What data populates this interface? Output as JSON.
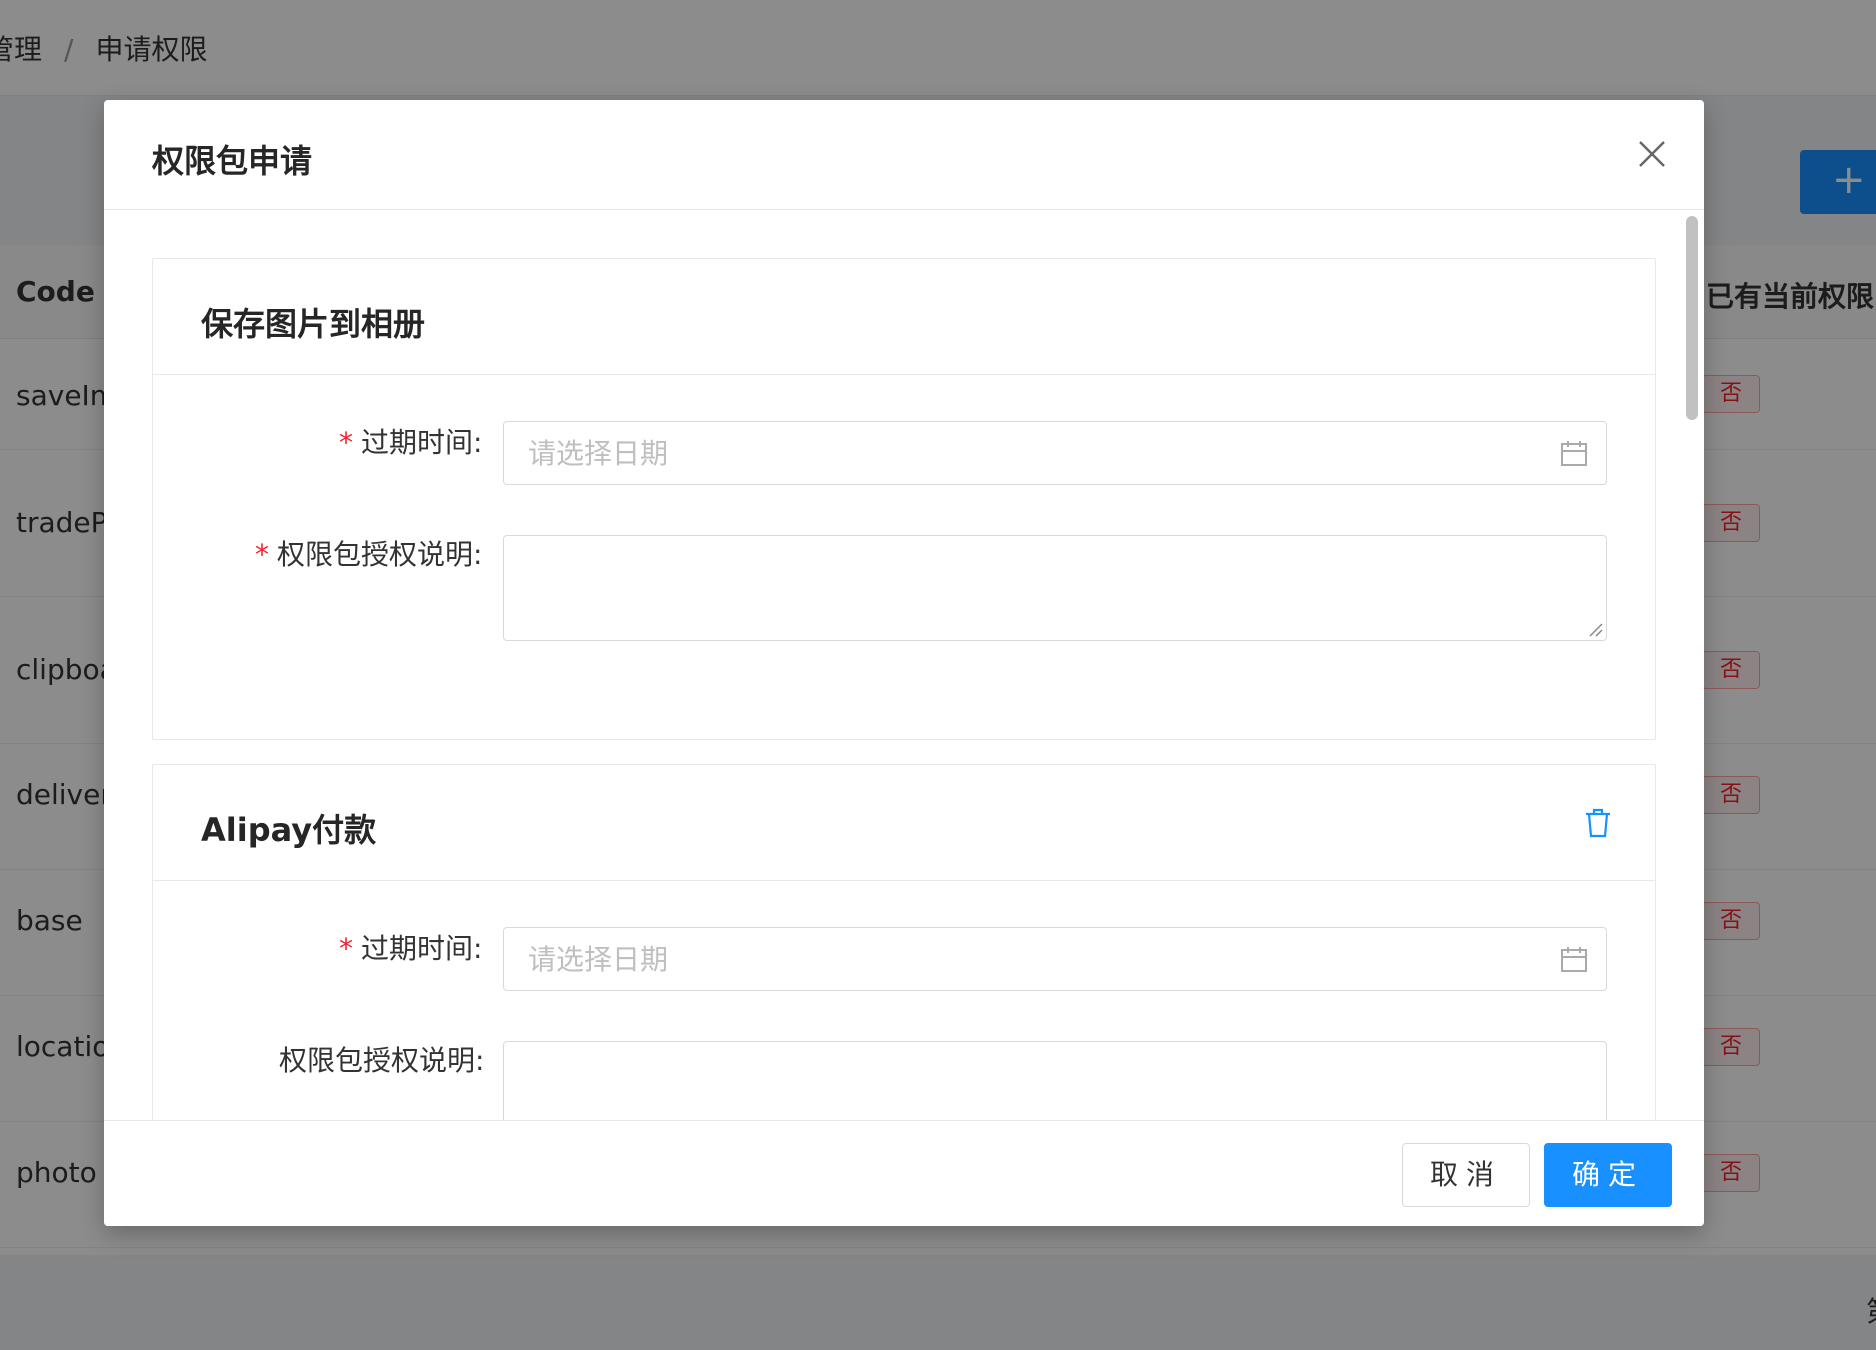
{
  "breadcrumb": {
    "parent": "管理",
    "separator": "/",
    "current": "申请权限"
  },
  "background": {
    "add_icon": "+",
    "table": {
      "headers": {
        "code": "Code",
        "has_permission": "已有当前权限"
      },
      "rows": [
        {
          "code": "saveIm",
          "has": "否"
        },
        {
          "code": "tradeP",
          "has": "否"
        },
        {
          "code": "clipboa",
          "has": "否"
        },
        {
          "code": "deliver",
          "has": "否"
        },
        {
          "code": "base",
          "has": "否"
        },
        {
          "code": "locatio",
          "has": "否"
        },
        {
          "code": "photo",
          "has": "否"
        }
      ]
    },
    "pager_char": "第"
  },
  "modal": {
    "title": "权限包申请",
    "close_icon": "close-icon",
    "sections": [
      {
        "title": "保存图片到相册",
        "expire_label": "过期时间:",
        "expire_required": "*",
        "date_placeholder": "请选择日期",
        "desc_label": "权限包授权说明:",
        "desc_required": "*"
      },
      {
        "title": "Alipay付款",
        "trash_icon": "trash-icon",
        "expire_label": "过期时间:",
        "expire_required": "*",
        "date_placeholder": "请选择日期",
        "desc_label": "权限包授权说明:"
      }
    ],
    "footer": {
      "cancel": "取消",
      "ok": "确定"
    }
  },
  "colors": {
    "primary": "#1890ff",
    "required": "#f5222d",
    "badge_text": "#f5222d",
    "badge_border": "#ffa39e"
  }
}
